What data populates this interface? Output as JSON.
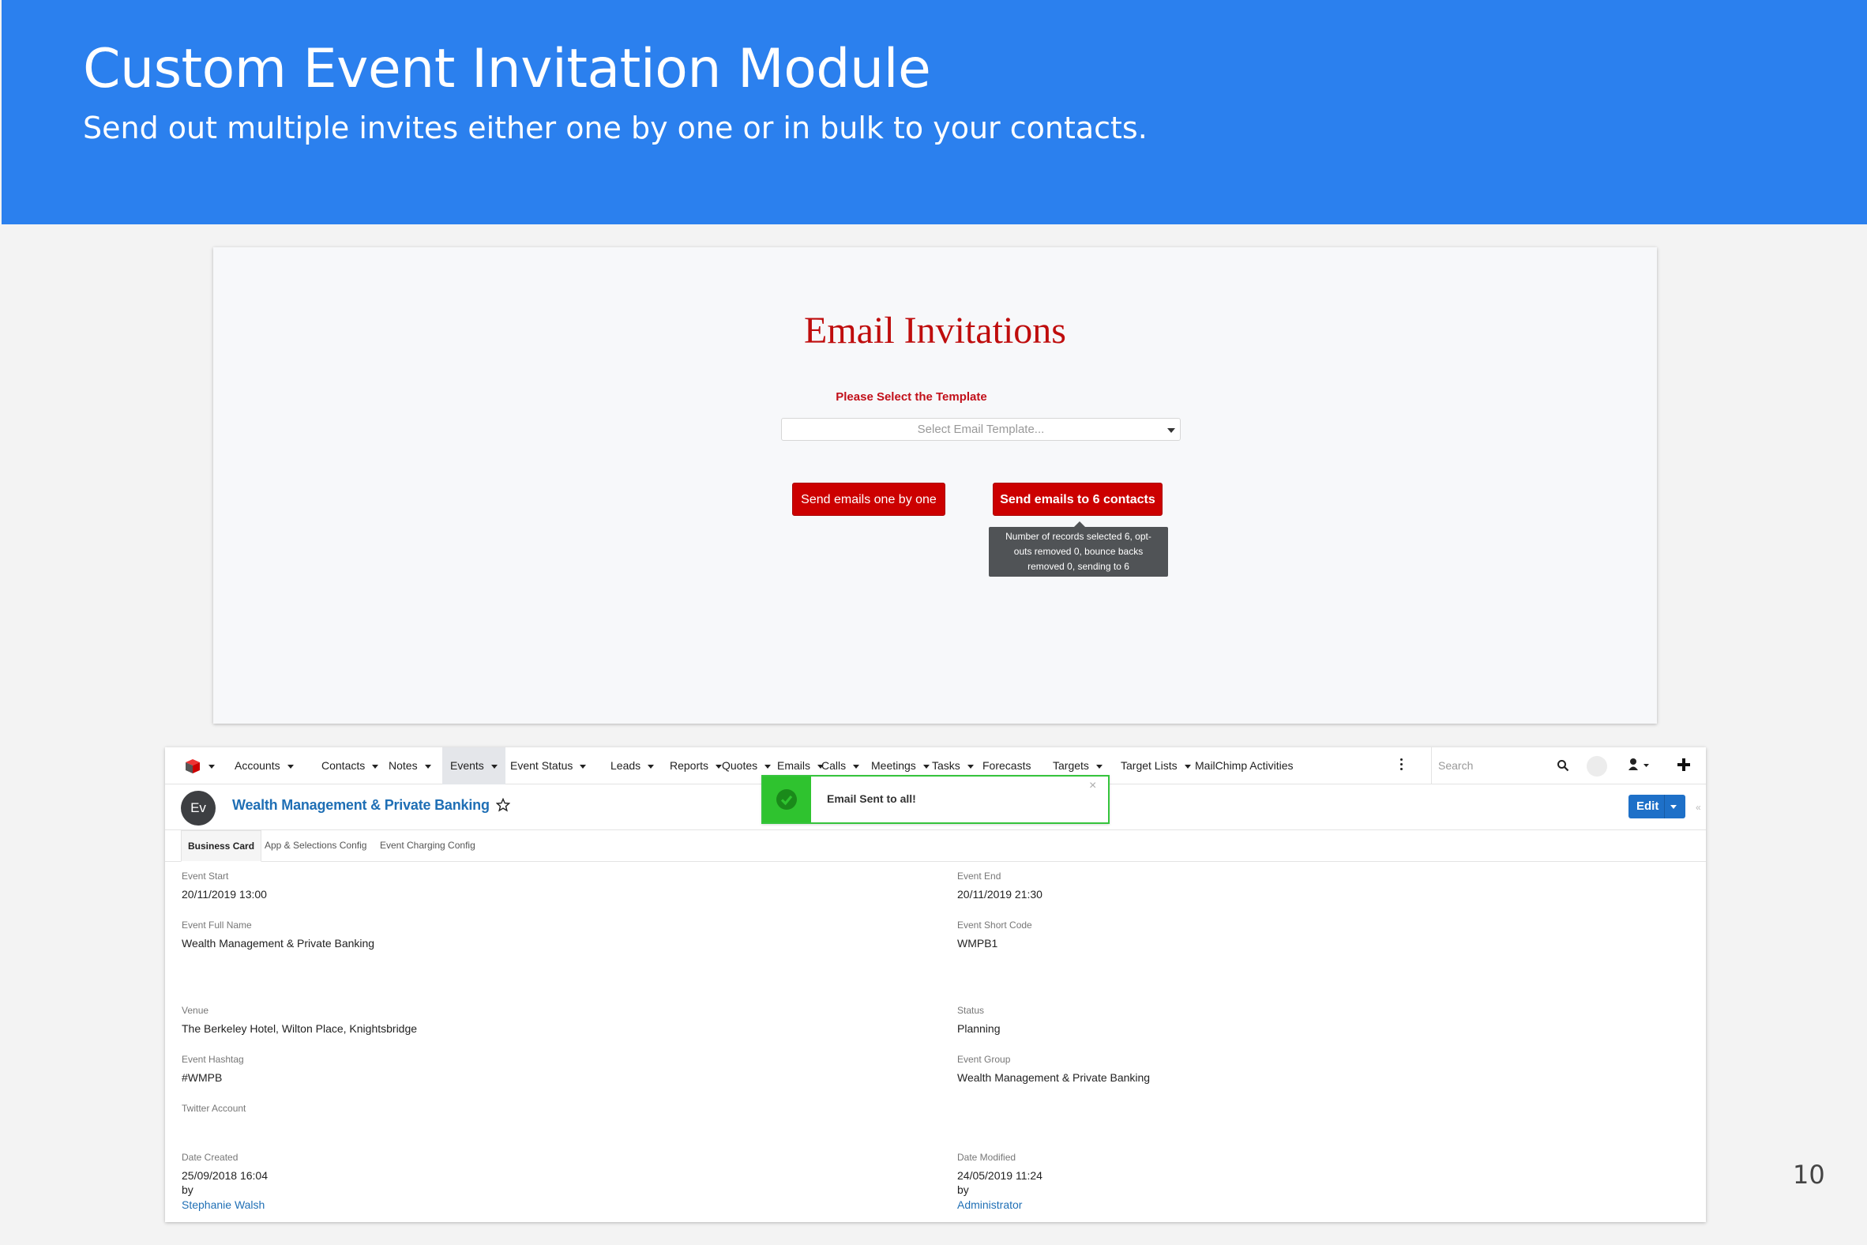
{
  "slide": {
    "title": "Custom Event Invitation Module",
    "subtitle": "Send out multiple invites either one by one or in bulk to your contacts.",
    "page_number": "10",
    "header_color": "#2b80ee"
  },
  "invitations": {
    "heading": "Email Invitations",
    "template_label": "Please Select the Template",
    "template_placeholder": "Select Email Template...",
    "send_one_by_one": "Send emails one by one",
    "send_bulk": "Send emails to 6 contacts",
    "tooltip_lines": [
      "Number of records selected 6, opt-",
      "outs removed 0, bounce backs",
      "removed 0, sending to 6"
    ]
  },
  "crm": {
    "nav": {
      "logo_icon": "cube-logo-icon",
      "items": [
        {
          "label": "Accounts",
          "dropdown": true
        },
        {
          "label": "Contacts",
          "dropdown": true
        },
        {
          "label": "Notes",
          "dropdown": true
        },
        {
          "label": "Events",
          "dropdown": true,
          "active": true
        },
        {
          "label": "Event Status",
          "dropdown": true
        },
        {
          "label": "Leads",
          "dropdown": true
        },
        {
          "label": "Reports",
          "dropdown": true
        },
        {
          "label": "Quotes",
          "dropdown": true
        },
        {
          "label": "Emails",
          "dropdown": true
        },
        {
          "label": "Calls",
          "dropdown": true
        },
        {
          "label": "Meetings",
          "dropdown": true
        },
        {
          "label": "Tasks",
          "dropdown": true
        },
        {
          "label": "Forecasts",
          "dropdown": false
        },
        {
          "label": "Targets",
          "dropdown": true
        },
        {
          "label": "Target Lists",
          "dropdown": true
        },
        {
          "label": "MailChimp Activities",
          "dropdown": false
        }
      ],
      "search_placeholder": "Search"
    },
    "record": {
      "badge": "Ev",
      "title": "Wealth Management & Private Banking",
      "edit_label": "Edit"
    },
    "toast": {
      "message": "Email Sent to all!",
      "close": "×"
    },
    "tabs": [
      "Business Card",
      "App & Selections Config",
      "Event Charging Config"
    ],
    "fields": {
      "event_start": {
        "label": "Event Start",
        "value": "20/11/2019 13:00"
      },
      "event_end": {
        "label": "Event End",
        "value": "20/11/2019 21:30"
      },
      "event_full_name": {
        "label": "Event Full Name",
        "value": "Wealth Management & Private Banking"
      },
      "event_short_code": {
        "label": "Event Short Code",
        "value": "WMPB1"
      },
      "venue": {
        "label": "Venue",
        "value": "The Berkeley Hotel, Wilton Place, Knightsbridge"
      },
      "status": {
        "label": "Status",
        "value": "Planning"
      },
      "event_hashtag": {
        "label": "Event Hashtag",
        "value": "#WMPB"
      },
      "event_group": {
        "label": "Event Group",
        "value": "Wealth Management & Private Banking"
      },
      "twitter_account": {
        "label": "Twitter Account",
        "value": ""
      },
      "date_created": {
        "label": "Date Created",
        "value": "25/09/2018 16:04",
        "by": "by",
        "user": "Stephanie Walsh"
      },
      "date_modified": {
        "label": "Date Modified",
        "value": "24/05/2019 11:24",
        "by": "by",
        "user": "Administrator"
      }
    }
  }
}
